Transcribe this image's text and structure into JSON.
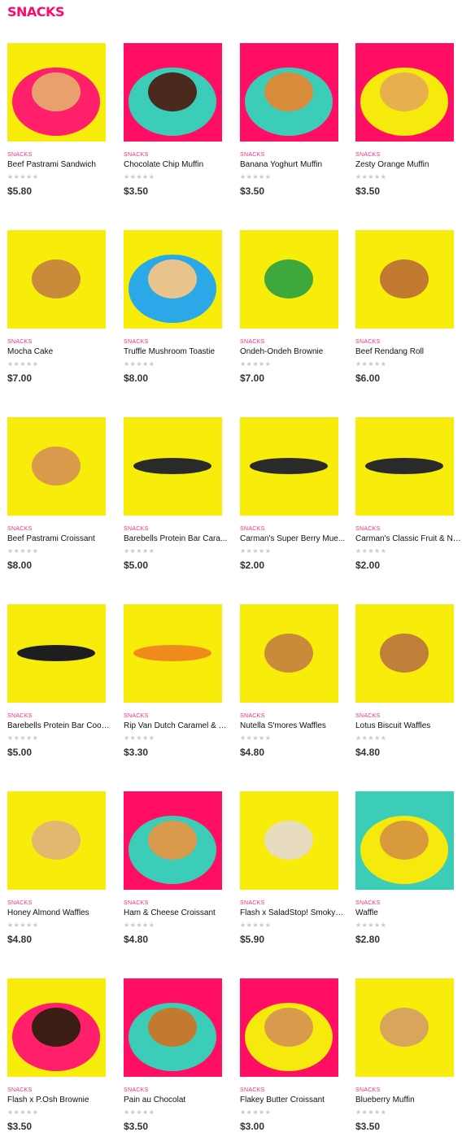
{
  "page": {
    "title": "SNACKS"
  },
  "colors": {
    "accent": "#ff0a6c"
  },
  "products": [
    {
      "category": "SNACKS",
      "name": "Beef Pastrami Sandwich",
      "price": "$5.80",
      "bg": "#f7ec0a",
      "plate": "#ff1f6a",
      "food": "#e8a06c",
      "icon": "sandwich-image"
    },
    {
      "category": "SNACKS",
      "name": "Chocolate Chip Muffin",
      "price": "$3.50",
      "bg": "#ff0e63",
      "plate": "#3ccdb8",
      "food": "#4a2a1c",
      "icon": "muffin-image"
    },
    {
      "category": "SNACKS",
      "name": "Banana Yoghurt Muffin",
      "price": "$3.50",
      "bg": "#ff0e63",
      "plate": "#3ccdb8",
      "food": "#d98b3c",
      "icon": "muffin-image"
    },
    {
      "category": "SNACKS",
      "name": "Zesty Orange Muffin",
      "price": "$3.50",
      "bg": "#ff0e63",
      "plate": "#f5ea0c",
      "food": "#e8b04c",
      "icon": "muffin-image"
    },
    {
      "category": "SNACKS",
      "name": "Mocha Cake",
      "price": "$7.00",
      "bg": "#f7ec0a",
      "plate": "",
      "food": "#c98a3a",
      "icon": "cake-image"
    },
    {
      "category": "SNACKS",
      "name": "Truffle Mushroom Toastie",
      "price": "$8.00",
      "bg": "#f7ec0a",
      "plate": "#2aa8e8",
      "food": "#e8c48c",
      "icon": "toastie-image"
    },
    {
      "category": "SNACKS",
      "name": "Ondeh-Ondeh Brownie",
      "price": "$7.00",
      "bg": "#f7ec0a",
      "plate": "",
      "food": "#3da83c",
      "icon": "brownie-image"
    },
    {
      "category": "SNACKS",
      "name": "Beef Rendang Roll",
      "price": "$6.00",
      "bg": "#f7ec0a",
      "plate": "",
      "food": "#c27a30",
      "icon": "roll-image"
    },
    {
      "category": "SNACKS",
      "name": "Beef Pastrami Croissant",
      "price": "$8.00",
      "bg": "#f7ec0a",
      "plate": "",
      "food": "#d99a4c",
      "icon": "croissant-image"
    },
    {
      "category": "SNACKS",
      "name": "Barebells Protein Bar Cara...",
      "price": "$5.00",
      "bg": "#f7ec0a",
      "plate": "",
      "food": "#2a2a2a",
      "icon": "protein-bar-image"
    },
    {
      "category": "SNACKS",
      "name": "Carman's Super Berry Mue...",
      "price": "$2.00",
      "bg": "#f7ec0a",
      "plate": "",
      "food": "#2a2a2a",
      "icon": "muesli-bar-image"
    },
    {
      "category": "SNACKS",
      "name": "Carman's Classic Fruit & Nu...",
      "price": "$2.00",
      "bg": "#f7ec0a",
      "plate": "",
      "food": "#2a2a2a",
      "icon": "muesli-bar-image"
    },
    {
      "category": "SNACKS",
      "name": "Barebells Protein Bar Cooki...",
      "price": "$5.00",
      "bg": "#f7ec0a",
      "plate": "",
      "food": "#1e1e1e",
      "icon": "protein-bar-image"
    },
    {
      "category": "SNACKS",
      "name": "Rip Van Dutch Caramel & V...",
      "price": "$3.30",
      "bg": "#f7ec0a",
      "plate": "",
      "food": "#f08a1c",
      "icon": "wafel-pack-image"
    },
    {
      "category": "SNACKS",
      "name": "Nutella S'mores Waffles",
      "price": "$4.80",
      "bg": "#f7ec0a",
      "plate": "",
      "food": "#c98a3a",
      "icon": "waffle-image"
    },
    {
      "category": "SNACKS",
      "name": "Lotus Biscuit Waffles",
      "price": "$4.80",
      "bg": "#f7ec0a",
      "plate": "",
      "food": "#c0803a",
      "icon": "waffle-image"
    },
    {
      "category": "SNACKS",
      "name": "Honey Almond Waffles",
      "price": "$4.80",
      "bg": "#f7ec0a",
      "plate": "",
      "food": "#e2b870",
      "icon": "waffle-image"
    },
    {
      "category": "SNACKS",
      "name": "Ham & Cheese Croissant",
      "price": "$4.80",
      "bg": "#ff0e63",
      "plate": "#3ccdb8",
      "food": "#d99a4c",
      "icon": "croissant-image"
    },
    {
      "category": "SNACKS",
      "name": "Flash x SaladStop! Smoky R...",
      "price": "$5.90",
      "bg": "#f7ec0a",
      "plate": "",
      "food": "#e8dcc0",
      "icon": "wrap-image"
    },
    {
      "category": "SNACKS",
      "name": "Waffle",
      "price": "$2.80",
      "bg": "#3ccdb8",
      "plate": "#f5ea0c",
      "food": "#d99a3c",
      "icon": "waffle-image"
    },
    {
      "category": "SNACKS",
      "name": "Flash x P.Osh Brownie",
      "price": "$3.50",
      "bg": "#f7ec0a",
      "plate": "#ff1f6a",
      "food": "#3a1e14",
      "icon": "brownie-image"
    },
    {
      "category": "SNACKS",
      "name": "Pain au Chocolat",
      "price": "$3.50",
      "bg": "#ff0e63",
      "plate": "#3ccdb8",
      "food": "#c27a30",
      "icon": "pastry-image"
    },
    {
      "category": "SNACKS",
      "name": "Flakey Butter Croissant",
      "price": "$3.00",
      "bg": "#ff0e63",
      "plate": "#f5ea0c",
      "food": "#d99a4c",
      "icon": "croissant-image"
    },
    {
      "category": "SNACKS",
      "name": "Blueberry Muffin",
      "price": "$3.50",
      "bg": "#f7ec0a",
      "plate": "",
      "food": "#d9a45c",
      "icon": "muffin-image"
    }
  ],
  "rating_stars": "★★★★★"
}
